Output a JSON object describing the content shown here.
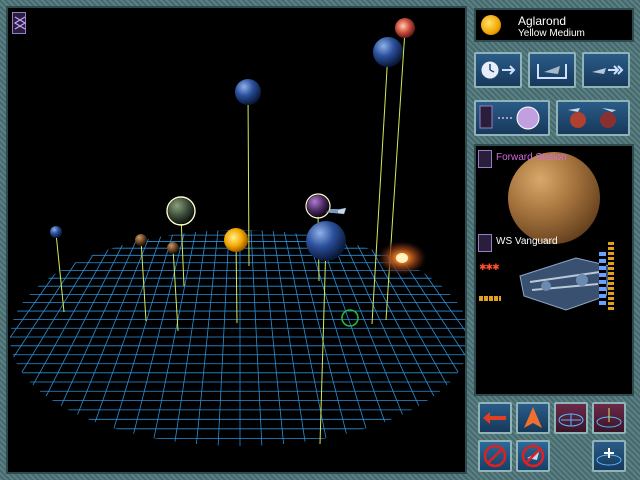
{
  "star": {
    "name": "Aglarond",
    "type": "Yellow Medium",
    "color": "#f5b400"
  },
  "selection": {
    "station": "Forward Station",
    "ship": "WS Vanguard"
  },
  "panel_icons": {
    "row1": [
      "time-advance-icon",
      "transfer-icon",
      "fleet-move-icon"
    ],
    "row2": [
      "planet-view-icon",
      "fleet-view-icon"
    ],
    "bottom": [
      "move-arrow-icon",
      "launch-icon",
      "grid-view-icon",
      "center-view-icon",
      "cancel-icon",
      "cancel-fleet-icon",
      "zoom-in-icon"
    ]
  },
  "colors": {
    "grid": "#2a8fd8",
    "stalk": "#d8e85a",
    "panel_border": "#8fb3b6",
    "selection_ring": "#ffffd0"
  }
}
